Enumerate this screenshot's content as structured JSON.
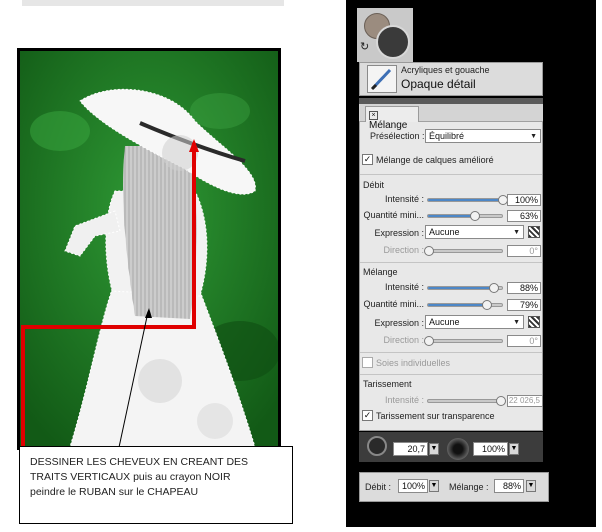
{
  "note": {
    "line1": "DESSINER LES CHEVEUX  EN CREANT DES",
    "line2": "TRAITS VERTICAUX   puis au crayon NOIR",
    "line3": "peindre le RUBAN sur le CHAPEAU"
  },
  "tool": {
    "category": "Acryliques et gouache",
    "variant": "Opaque détail"
  },
  "mix_panel": {
    "tab_label": "Mélange",
    "preset_label": "Présélection :",
    "preset_value": "Équilibré",
    "layer_mix_label": "Mélange de calques amélioré",
    "layer_mix_checked": "✓",
    "debit": {
      "title": "Débit",
      "intensity_label": "Intensité :",
      "intensity_value": "100%",
      "intensity_level": 1.0,
      "min_qty_label": "Quantité mini...",
      "min_qty_value": "63%",
      "min_qty_level": 0.63,
      "expression_label": "Expression :",
      "expression_value": "Aucune",
      "direction_label": "Direction :",
      "direction_value": "0°"
    },
    "melange": {
      "title": "Mélange",
      "intensity_label": "Intensité :",
      "intensity_value": "88%",
      "intensity_level": 0.88,
      "min_qty_label": "Quantité mini...",
      "min_qty_value": "79%",
      "min_qty_level": 0.79,
      "expression_label": "Expression :",
      "expression_value": "Aucune",
      "direction_label": "Direction :",
      "direction_value": "0°"
    },
    "soies_label": "Soies individuelles",
    "tarissement": {
      "title": "Tarissement",
      "intensity_label": "Intensité :",
      "intensity_value": "22 026,5",
      "transparency_label": "Tarissement sur transparence",
      "transparency_checked": "✓"
    }
  },
  "brush_bar": {
    "size_value": "20,7",
    "opacity_value": "100%"
  },
  "status_bar": {
    "debit_label": "Débit :",
    "debit_value": "100%",
    "melange_label": "Mélange :",
    "melange_value": "88%"
  },
  "colors": {
    "panel_bg": "#000000",
    "accent_slider": "#4d87c7",
    "annotation_red": "#e00000",
    "painting_green": "#1f7a22"
  }
}
